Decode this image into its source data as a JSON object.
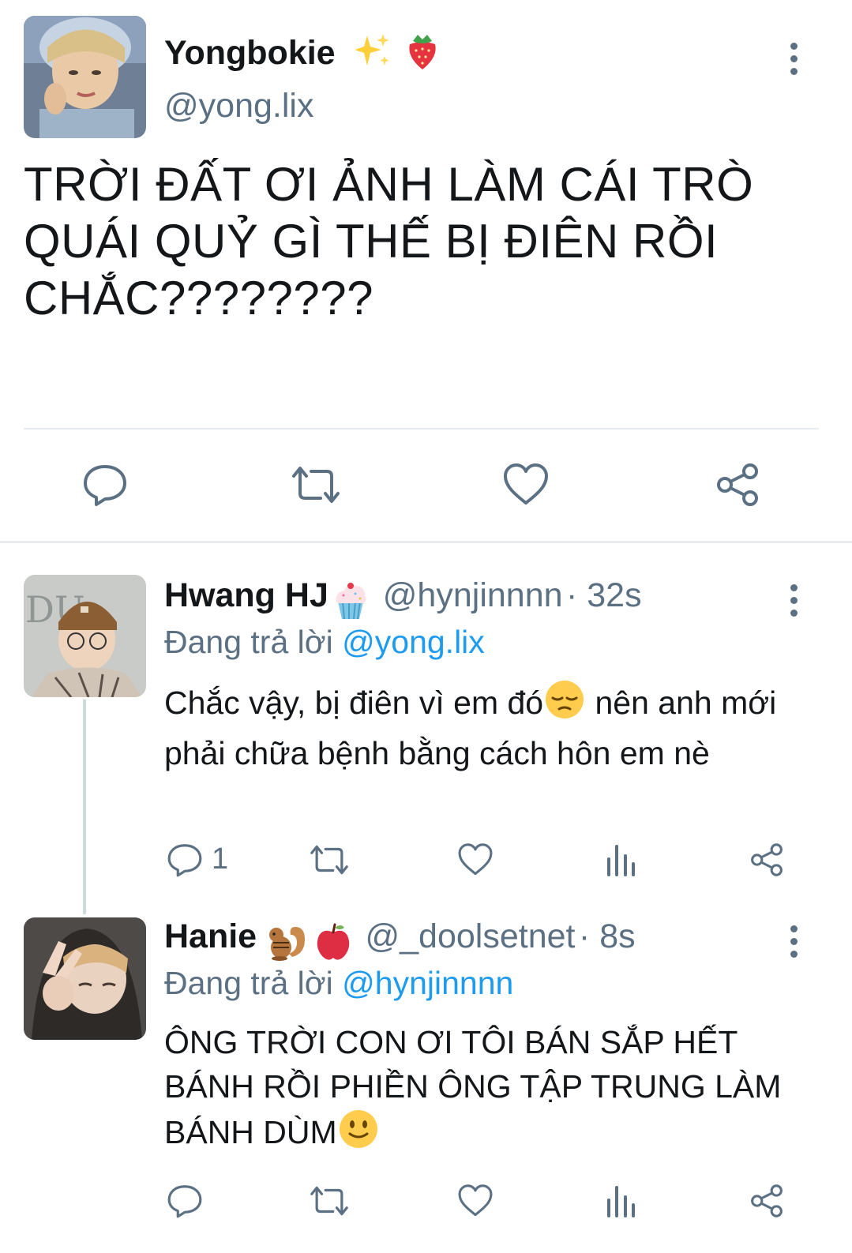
{
  "main_tweet": {
    "display_name": "Yongbokie",
    "name_emoji_icons": [
      "sparkles-icon",
      "strawberry-icon"
    ],
    "handle": "@yong.lix",
    "text": "TRỜI ĐẤT ƠI ẢNH LÀM CÁI TRÒ QUÁI QUỶ GÌ THẾ BỊ ĐIÊN RỒI CHẮC????????",
    "actions": [
      "reply-icon",
      "retweet-icon",
      "like-icon",
      "share-icon"
    ]
  },
  "replies": [
    {
      "display_name": "Hwang HJ",
      "name_emoji_icon": "cupcake-icon",
      "handle": "@hynjinnnn",
      "time": "· 32s",
      "replying_label": "Đang trả lời",
      "replying_to": "@yong.lix",
      "text_before_emoji": "Chắc vậy, bị điên vì em đó",
      "emoji_icon": "pensive-face-icon",
      "text_after_emoji": " nên anh mới phải chữa bệnh bằng cách hôn em nè",
      "reply_count": "1"
    },
    {
      "display_name": "Hanie",
      "name_emoji_icons": [
        "chipmunk-icon",
        "apple-icon"
      ],
      "handle": "@_doolsetnet",
      "time": "· 8s",
      "replying_label": "Đang trả lời",
      "replying_to": "@hynjinnnn",
      "text_before_emoji": "ÔNG TRỜI CON ƠI TÔI BÁN SẮP HẾT BÁNH RỒI PHIỀN ÔNG TẬP TRUNG LÀM BÁNH DÙM",
      "emoji_icon": "slight-smile-icon"
    }
  ],
  "colors": {
    "text": "#14171a",
    "secondary": "#5b7083",
    "link": "#1d9bf0",
    "divider": "#e6ecf0"
  }
}
